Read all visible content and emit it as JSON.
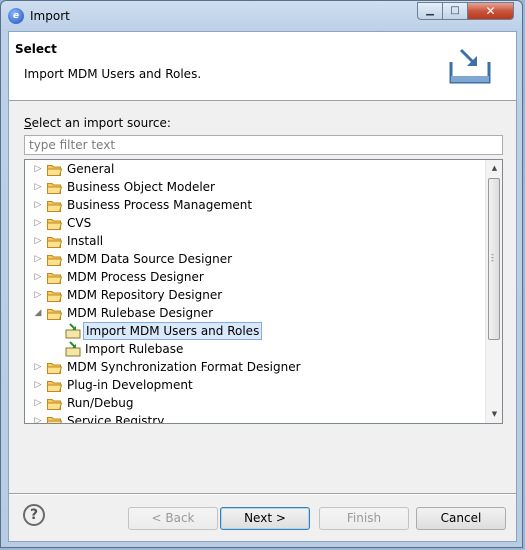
{
  "window": {
    "title": "Import",
    "minimize_glyph": "▁",
    "maximize_glyph": "□",
    "close_glyph": "✕"
  },
  "header": {
    "title": "Select",
    "description": "Import MDM Users and Roles."
  },
  "source": {
    "label_first": "S",
    "label_rest": "elect an import source:",
    "filter_placeholder": "type filter text",
    "filter_value": ""
  },
  "tree": [
    {
      "label": "General",
      "expanded": false,
      "level": 0,
      "icon": "folder-icon"
    },
    {
      "label": "Business Object Modeler",
      "expanded": false,
      "level": 0,
      "icon": "folder-icon"
    },
    {
      "label": "Business Process Management",
      "expanded": false,
      "level": 0,
      "icon": "folder-icon"
    },
    {
      "label": "CVS",
      "expanded": false,
      "level": 0,
      "icon": "folder-icon"
    },
    {
      "label": "Install",
      "expanded": false,
      "level": 0,
      "icon": "folder-icon"
    },
    {
      "label": "MDM Data Source Designer",
      "expanded": false,
      "level": 0,
      "icon": "folder-icon"
    },
    {
      "label": "MDM Process Designer",
      "expanded": false,
      "level": 0,
      "icon": "folder-icon"
    },
    {
      "label": "MDM Repository Designer",
      "expanded": false,
      "level": 0,
      "icon": "folder-icon"
    },
    {
      "label": "MDM Rulebase Designer",
      "expanded": true,
      "level": 0,
      "icon": "folder-icon"
    },
    {
      "label": "Import MDM Users and Roles",
      "level": 1,
      "icon": "import-wizard-icon",
      "selected": true
    },
    {
      "label": "Import Rulebase",
      "level": 1,
      "icon": "import-wizard-icon"
    },
    {
      "label": "MDM Synchronization Format Designer",
      "expanded": false,
      "level": 0,
      "icon": "folder-icon"
    },
    {
      "label": "Plug-in Development",
      "expanded": false,
      "level": 0,
      "icon": "folder-icon"
    },
    {
      "label": "Run/Debug",
      "expanded": false,
      "level": 0,
      "icon": "folder-icon"
    },
    {
      "label": "Service Registry",
      "expanded": false,
      "level": 0,
      "icon": "folder-icon"
    }
  ],
  "buttons": {
    "help_glyph": "?",
    "back": "< Back",
    "next": "Next >",
    "finish": "Finish",
    "cancel": "Cancel"
  },
  "colors": {
    "selection_bg": "#d9e8fb",
    "selection_border": "#84acdd",
    "folder_fill": "#f6c95a",
    "close_red": "#c8553b"
  }
}
